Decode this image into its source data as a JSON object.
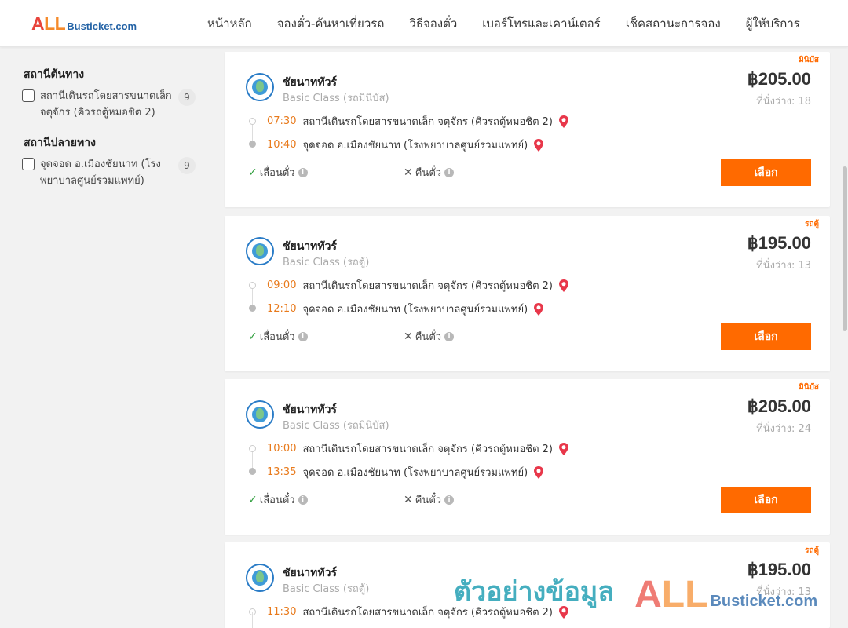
{
  "header": {
    "logo_all_a": "A",
    "logo_all_ll": "LL",
    "logo_rest": "Busticket.com",
    "nav": [
      "หน้าหลัก",
      "จองตั๋ว-ค้นหาเที่ยวรถ",
      "วิธีจองตั๋ว",
      "เบอร์โทรและเคาน์เตอร์",
      "เช็คสถานะการจอง",
      "ผู้ให้บริการ"
    ]
  },
  "sidebar": {
    "origin_title": "สถานีต้นทาง",
    "origin_filters": [
      {
        "label": "สถานีเดินรถโดยสารขนาดเล็ก จตุจักร (คิวรถตู้หมอชิต 2)",
        "count": "9"
      }
    ],
    "dest_title": "สถานีปลายทาง",
    "dest_filters": [
      {
        "label": "จุดจอด อ.เมืองชัยนาท (โรงพยาบาลศูนย์รวมแพทย์)",
        "count": "9"
      }
    ]
  },
  "trips": [
    {
      "badge": "มินิบัส",
      "operator": "ชัยนาททัวร์",
      "class": "Basic Class (รถมินิบัส)",
      "price": "฿205.00",
      "seats": "ที่นั่งว่าง: 18",
      "depart_time": "07:30",
      "depart_station": "สถานีเดินรถโดยสารขนาดเล็ก จตุจักร (คิวรถตู้หมอชิต 2)",
      "arrive_time": "10:40",
      "arrive_station": "จุดจอด อ.เมืองชัยนาท (โรงพยาบาลศูนย์รวมแพทย์)",
      "reschedule": "เลื่อนตั๋ว",
      "refund": "คืนตั๋ว",
      "select": "เลือก"
    },
    {
      "badge": "รถตู้",
      "operator": "ชัยนาททัวร์",
      "class": "Basic Class (รถตู้)",
      "price": "฿195.00",
      "seats": "ที่นั่งว่าง: 13",
      "depart_time": "09:00",
      "depart_station": "สถานีเดินรถโดยสารขนาดเล็ก จตุจักร (คิวรถตู้หมอชิต 2)",
      "arrive_time": "12:10",
      "arrive_station": "จุดจอด อ.เมืองชัยนาท (โรงพยาบาลศูนย์รวมแพทย์)",
      "reschedule": "เลื่อนตั๋ว",
      "refund": "คืนตั๋ว",
      "select": "เลือก"
    },
    {
      "badge": "มินิบัส",
      "operator": "ชัยนาททัวร์",
      "class": "Basic Class (รถมินิบัส)",
      "price": "฿205.00",
      "seats": "ที่นั่งว่าง: 24",
      "depart_time": "10:00",
      "depart_station": "สถานีเดินรถโดยสารขนาดเล็ก จตุจักร (คิวรถตู้หมอชิต 2)",
      "arrive_time": "13:35",
      "arrive_station": "จุดจอด อ.เมืองชัยนาท (โรงพยาบาลศูนย์รวมแพทย์)",
      "reschedule": "เลื่อนตั๋ว",
      "refund": "คืนตั๋ว",
      "select": "เลือก"
    },
    {
      "badge": "รถตู้",
      "operator": "ชัยนาททัวร์",
      "class": "Basic Class (รถตู้)",
      "price": "฿195.00",
      "seats": "ที่นั่งว่าง: 13",
      "depart_time": "11:30",
      "depart_station": "สถานีเดินรถโดยสารขนาดเล็ก จตุจักร (คิวรถตู้หมอชิต 2)",
      "arrive_time": "",
      "arrive_station": "",
      "reschedule": "",
      "refund": "",
      "select": ""
    }
  ],
  "watermark": {
    "text": "ตัวอย่างข้อมูล",
    "all_a": "A",
    "all_ll": "LL",
    "rest": "Busticket.com"
  },
  "colors": {
    "accent": "#ff6a00",
    "time": "#e87a1c",
    "pin": "#e8374a"
  },
  "icons": {
    "pin": "map-pin-icon",
    "check": "check-icon",
    "cross": "cross-icon",
    "info": "info-icon"
  }
}
